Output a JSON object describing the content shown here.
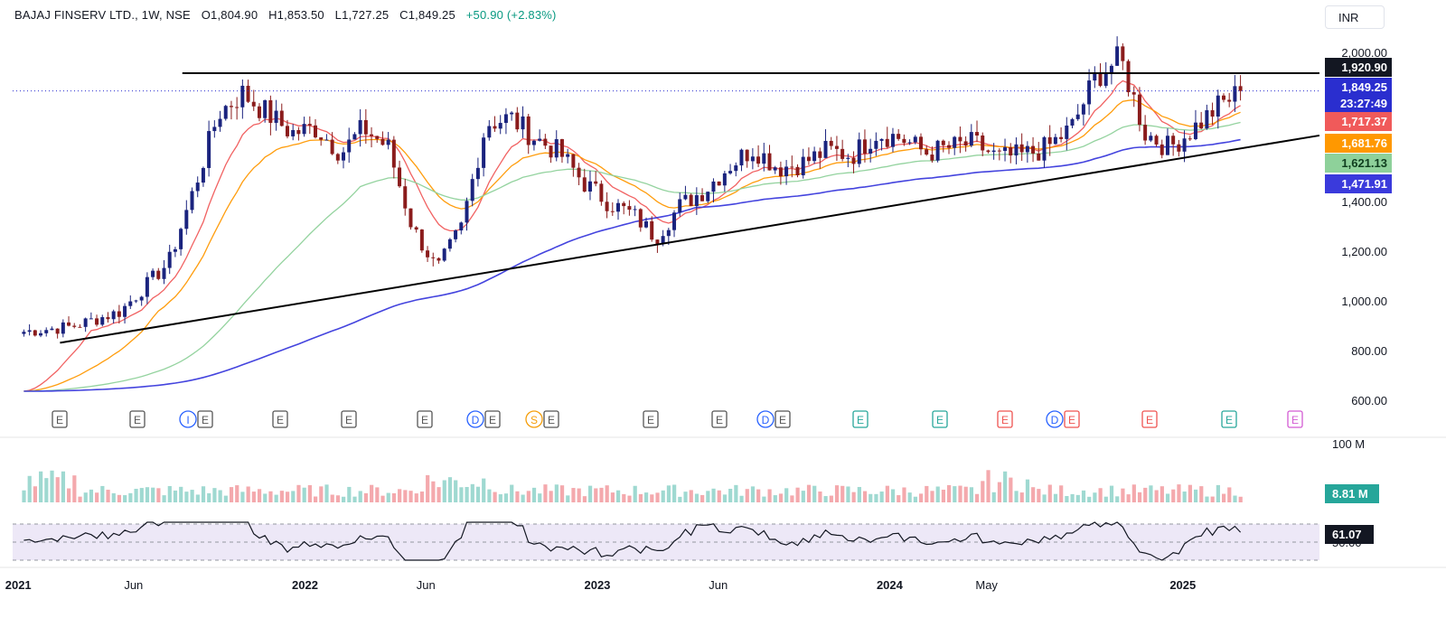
{
  "header": {
    "symbol": "BAJAJ FINSERV LTD., 1W, NSE",
    "open": "O1,804.90",
    "high": "H1,853.50",
    "low": "L1,727.25",
    "close": "C1,849.25",
    "change": "+50.90 (+2.83%)"
  },
  "currency_button": "INR",
  "chart_data": {
    "type": "candlestick",
    "interval": "1W",
    "x_range": [
      "2021-01",
      "2025-03"
    ],
    "x_tick_labels": [
      "2021",
      "Jun",
      "2022",
      "Jun",
      "2023",
      "Jun",
      "2024",
      "May",
      "2025"
    ],
    "y_tick_labels": [
      "2,000.00",
      "1,400.00",
      "1,200.00",
      "1,000.00",
      "800.00",
      "600.00"
    ],
    "ylim": [
      560,
      2070
    ],
    "grid": false,
    "closes_key_points": [
      {
        "date": "2021-01",
        "close": 880
      },
      {
        "date": "2021-03",
        "close": 900
      },
      {
        "date": "2021-05",
        "close": 960
      },
      {
        "date": "2021-07",
        "close": 1160
      },
      {
        "date": "2021-08",
        "close": 1450
      },
      {
        "date": "2021-09",
        "close": 1760
      },
      {
        "date": "2021-10",
        "close": 1840
      },
      {
        "date": "2021-12",
        "close": 1680
      },
      {
        "date": "2022-01",
        "close": 1700
      },
      {
        "date": "2022-02",
        "close": 1600
      },
      {
        "date": "2022-03",
        "close": 1700
      },
      {
        "date": "2022-04",
        "close": 1620
      },
      {
        "date": "2022-05",
        "close": 1300
      },
      {
        "date": "2022-06",
        "close": 1130
      },
      {
        "date": "2022-07",
        "close": 1300
      },
      {
        "date": "2022-08",
        "close": 1720
      },
      {
        "date": "2022-09",
        "close": 1740
      },
      {
        "date": "2022-10",
        "close": 1660
      },
      {
        "date": "2022-11",
        "close": 1600
      },
      {
        "date": "2022-12",
        "close": 1480
      },
      {
        "date": "2023-01",
        "close": 1400
      },
      {
        "date": "2023-02",
        "close": 1350
      },
      {
        "date": "2023-03",
        "close": 1260
      },
      {
        "date": "2023-04",
        "close": 1390
      },
      {
        "date": "2023-05",
        "close": 1450
      },
      {
        "date": "2023-06",
        "close": 1550
      },
      {
        "date": "2023-07",
        "close": 1620
      },
      {
        "date": "2023-08",
        "close": 1540
      },
      {
        "date": "2023-09",
        "close": 1560
      },
      {
        "date": "2023-10",
        "close": 1610
      },
      {
        "date": "2023-11",
        "close": 1590
      },
      {
        "date": "2023-12",
        "close": 1680
      },
      {
        "date": "2024-01",
        "close": 1660
      },
      {
        "date": "2024-02",
        "close": 1600
      },
      {
        "date": "2024-03",
        "close": 1620
      },
      {
        "date": "2024-04",
        "close": 1640
      },
      {
        "date": "2024-05",
        "close": 1580
      },
      {
        "date": "2024-06",
        "close": 1590
      },
      {
        "date": "2024-07",
        "close": 1620
      },
      {
        "date": "2024-08",
        "close": 1700
      },
      {
        "date": "2024-09",
        "close": 1910
      },
      {
        "date": "2024-10",
        "close": 1980
      },
      {
        "date": "2024-11",
        "close": 1680
      },
      {
        "date": "2024-12",
        "close": 1620
      },
      {
        "date": "2025-01",
        "close": 1700
      },
      {
        "date": "2025-02",
        "close": 1790
      },
      {
        "date": "2025-03",
        "close": 1849.25
      }
    ],
    "lines": [
      {
        "kind": "horizontal_resistance",
        "value": 1920.9,
        "from": "2021-09",
        "to": "2025-03"
      },
      {
        "kind": "rising_trendline",
        "from": {
          "date": "2021-01",
          "value": 835
        },
        "to": {
          "date": "2025-04",
          "value": 1670
        }
      }
    ],
    "moving_averages": [
      {
        "value_label": "1,717.37",
        "color": "#f05a5a",
        "value": 1717.37
      },
      {
        "value_label": "1,681.76",
        "color": "#ff9800",
        "value": 1681.76
      },
      {
        "value_label": "1,621.13",
        "color": "#8ed19a",
        "value": 1621.13
      },
      {
        "value_label": "1,471.91",
        "color": "#3a3adc",
        "value": 1471.91
      }
    ],
    "price_labels": [
      {
        "text": "1,920.90",
        "bg": "#131722",
        "color": "#ffffff",
        "value": 1920.9
      },
      {
        "text": "1,849.25",
        "bg": "#2a2ecf",
        "color": "#ffffff",
        "value": 1849.25
      },
      {
        "text": "23:27:49",
        "bg": "#2a2ecf",
        "color": "#ffffff"
      }
    ],
    "event_markers": [
      {
        "labels": [
          "E"
        ],
        "style": "gray"
      },
      {
        "labels": [
          "E"
        ],
        "style": "gray"
      },
      {
        "labels": [
          "I",
          "E"
        ],
        "style": "mixed"
      },
      {
        "labels": [
          "E"
        ],
        "style": "gray"
      },
      {
        "labels": [
          "E"
        ],
        "style": "gray"
      },
      {
        "labels": [
          "E"
        ],
        "style": "gray"
      },
      {
        "labels": [
          "D",
          "E"
        ],
        "style": "dividend"
      },
      {
        "labels": [
          "S",
          "E"
        ],
        "style": "split"
      },
      {
        "labels": [
          "E"
        ],
        "style": "gray"
      },
      {
        "labels": [
          "E"
        ],
        "style": "gray"
      },
      {
        "labels": [
          "D",
          "E"
        ],
        "style": "dividend"
      },
      {
        "labels": [
          "E"
        ],
        "style": "green"
      },
      {
        "labels": [
          "E"
        ],
        "style": "green"
      },
      {
        "labels": [
          "E"
        ],
        "style": "red"
      },
      {
        "labels": [
          "D",
          "E"
        ],
        "style": "dividend-red"
      },
      {
        "labels": [
          "E"
        ],
        "style": "red"
      },
      {
        "labels": [
          "E"
        ],
        "style": "green"
      },
      {
        "labels": [
          "E"
        ],
        "style": "purple"
      }
    ],
    "volume": {
      "scale_label": "100 M",
      "last_label": "8.81 M",
      "last_value_millions": 8.81,
      "up_color": "#9fd9d1",
      "down_color": "#f4a9ad"
    },
    "rsi": {
      "last_label": "61.07",
      "last_value": 61.07,
      "level_label": "50.00",
      "overbought": 70,
      "oversold": 30,
      "band_color": "#ede8f7"
    }
  },
  "colors": {
    "up": "#26a69a",
    "down": "#ef5350",
    "up_dark": "#1a237e",
    "down_dark": "#8b1c1c",
    "ma_red": "#f05a5a",
    "ma_orange": "#ff9800",
    "ma_green": "#8ed19a",
    "ma_blue": "#3a3adc"
  }
}
